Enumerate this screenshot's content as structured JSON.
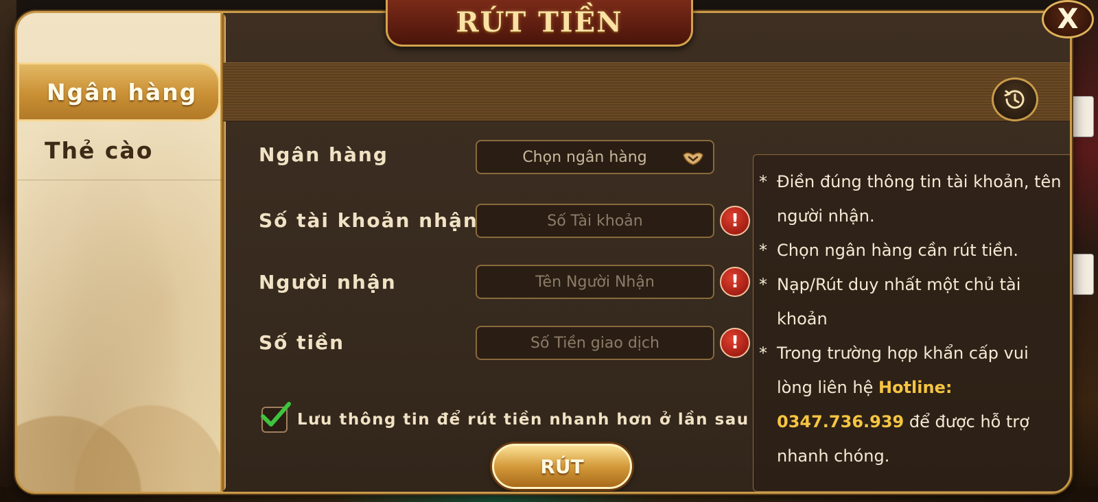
{
  "title": "RÚT TIỀN",
  "close_label": "X",
  "tabs": [
    {
      "label": "Ngân hàng",
      "active": true
    },
    {
      "label": "Thẻ cào",
      "active": false
    }
  ],
  "form": {
    "bank": {
      "label": "Ngân hàng",
      "placeholder": "Chọn ngân hàng"
    },
    "account": {
      "label": "Số tài khoản nhận",
      "placeholder": "Số Tài khoản"
    },
    "receiver": {
      "label": "Người nhận",
      "placeholder": "Tên Người Nhận"
    },
    "amount": {
      "label": "Số tiền",
      "placeholder": "Số Tiền giao dịch"
    },
    "warn_symbol": "!",
    "save_info": {
      "label": "Lưu thông tin để rút tiền nhanh hơn ở lần sau",
      "checked": true
    },
    "submit_label": "RÚT"
  },
  "info": {
    "bullet": "*",
    "lines": [
      "Điền đúng thông tin tài khoản, tên người nhận.",
      "Chọn ngân hàng cần rút tiền.",
      "Nạp/Rút duy nhất một chủ tài khoản"
    ],
    "last_prefix": "Trong trường hợp khẩn cấp vui lòng liên hệ",
    "hotline_label": "Hotline:",
    "hotline_number": "0347.736.939",
    "last_suffix": "để được hỗ trợ nhanh chóng."
  },
  "colors": {
    "accent_gold": "#c99a4a",
    "highlight": "#f5c542",
    "warning_red": "#d03020",
    "check_green": "#3ec43e"
  },
  "icons": {
    "history": "history-clock-icon",
    "dropdown": "chevron-down-icon",
    "warning": "exclamation-icon",
    "close": "close-icon",
    "check": "checkmark-icon"
  }
}
